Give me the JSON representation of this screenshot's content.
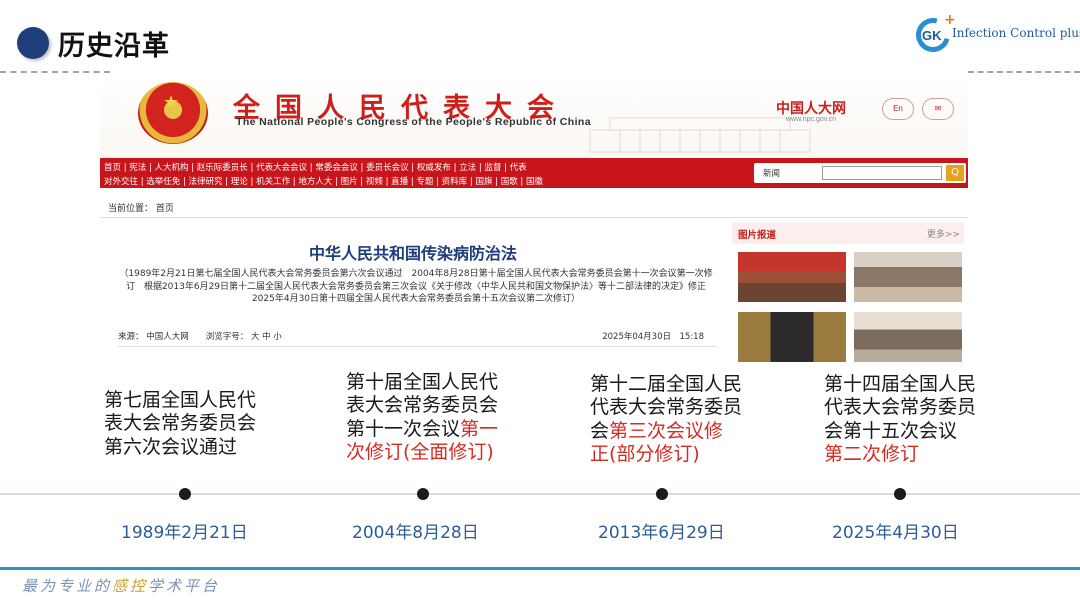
{
  "slide": {
    "title": "历史沿革",
    "logo_letters": "GK",
    "logo_plus": "+",
    "logo_text": "Infection Control plus"
  },
  "npc_page": {
    "name": "全国人民代表大会",
    "name_en": "The National People's Congress of the People's Republic of China",
    "site_name": "中国人大网",
    "site_url": "www.npc.gov.cn",
    "btn_en": "En",
    "btn_mail": "✉",
    "nav_row1": "首页 | 宪法 | 人大机构 | 赵乐际委员长 | 代表大会会议 | 常委会会议 | 委员长会议 | 权威发布 | 立法 | 监督 | 代表",
    "nav_row2": "对外交往 | 选举任免 | 法律研究 | 理论 | 机关工作 | 地方人大 | 图片 | 视频 | 直播 | 专题 | 资料库 | 国旗 | 国歌 | 国徽",
    "search_label": "新闻",
    "search_value": "",
    "search_button": "Q",
    "breadcrumb": "当前位置：  首页",
    "law_title": "中华人民共和国传染病防治法",
    "law_note": "（1989年2月21日第七届全国人民代表大会常务委员会第六次会议通过　2004年8月28日第十届全国人民代表大会常务委员会第十一次会议第一次修订　根据2013年6月29日第十二届全国人民代表大会常务委员会第三次会议《关于修改〈中华人民共和国文物保护法〉等十二部法律的决定》修正　2025年4月30日第十四届全国人民代表大会常务委员会第十五次会议第二次修订）",
    "meta_source": "来源：  中国人大网　　浏览字号：  大  中  小",
    "meta_date": "2025年04月30日　15:18",
    "photo_title": "图片报道",
    "photo_more": "更多>>"
  },
  "timeline": [
    {
      "plain": "第七届全国人民代表大会常务委员会第六次会议通过",
      "highlight": "",
      "date": "1989年2月21日"
    },
    {
      "plain": "第十届全国人民代表大会常务委员会第十一次会议",
      "highlight": "第一次修订(全面修订)",
      "date": "2004年8月28日"
    },
    {
      "plain": "第十二届全国人民代表大会常务委员会",
      "highlight": "第三次会议修正(部分修订)",
      "date": "2013年6月29日"
    },
    {
      "plain": "第十四届全国人民代表大会常务委员会第十五次会议",
      "highlight": "第二次修订",
      "date": "2025年4月30日"
    }
  ],
  "footer": {
    "slogan_a": "最为专业的",
    "slogan_b": "感控",
    "slogan_c": "学术平台"
  },
  "colors": {
    "accent_blue": "#2a8fd0",
    "title_dot": "#1f3f7a",
    "highlight_red": "#d42b22",
    "date_blue": "#2b5d99",
    "npc_red": "#c8151b"
  }
}
